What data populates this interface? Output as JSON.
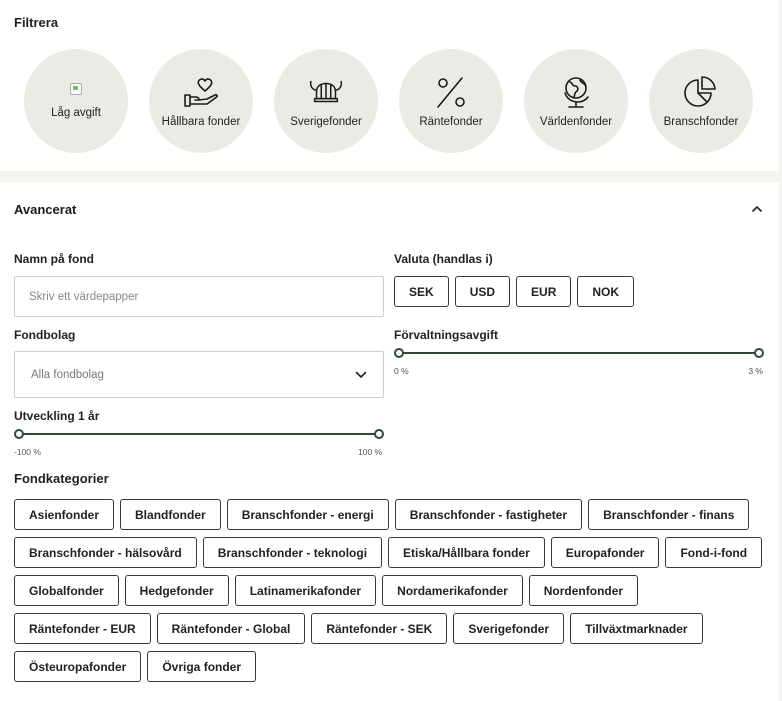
{
  "filter": {
    "title": "Filtrera",
    "items": [
      {
        "label": "Låg avgift",
        "icon": "broken-image-icon"
      },
      {
        "label": "Hållbara fonder",
        "icon": "heart-hand-icon"
      },
      {
        "label": "Sverigefonder",
        "icon": "viking-helmet-icon"
      },
      {
        "label": "Räntefonder",
        "icon": "percent-icon"
      },
      {
        "label": "Världenfonder",
        "icon": "globe-icon"
      },
      {
        "label": "Branschfonder",
        "icon": "pie-chart-icon"
      }
    ]
  },
  "advanced": {
    "title": "Avancerat",
    "name_label": "Namn på fond",
    "name_placeholder": "Skriv ett värdepapper",
    "currency_label": "Valuta (handlas i)",
    "currencies": [
      "SEK",
      "USD",
      "EUR",
      "NOK"
    ],
    "company_label": "Fondbolag",
    "company_value": "Alla fondbolag",
    "fee_label": "Förvaltningsavgift",
    "fee_min": "0 %",
    "fee_max": "3 %",
    "perf_label": "Utveckling 1 år",
    "perf_min": "-100 %",
    "perf_max": "100 %",
    "categories_label": "Fondkategorier",
    "categories": [
      "Asienfonder",
      "Blandfonder",
      "Branschfonder - energi",
      "Branschfonder - fastigheter",
      "Branschfonder - finans",
      "Branschfonder - hälsovård",
      "Branschfonder - teknologi",
      "Etiska/Hållbara fonder",
      "Europafonder",
      "Fond-i-fond",
      "Globalfonder",
      "Hedgefonder",
      "Latinamerikafonder",
      "Nordamerikafonder",
      "Nordenfonder",
      "Räntefonder - EUR",
      "Räntefonder - Global",
      "Räntefonder - SEK",
      "Sverigefonder",
      "Tillväxtmarknader",
      "Östeuropafonder",
      "Övriga fonder"
    ]
  },
  "colors": {
    "accent": "#2e4a37",
    "circle_bg": "#ebebe6",
    "page_bg": "#f3f3f0"
  }
}
